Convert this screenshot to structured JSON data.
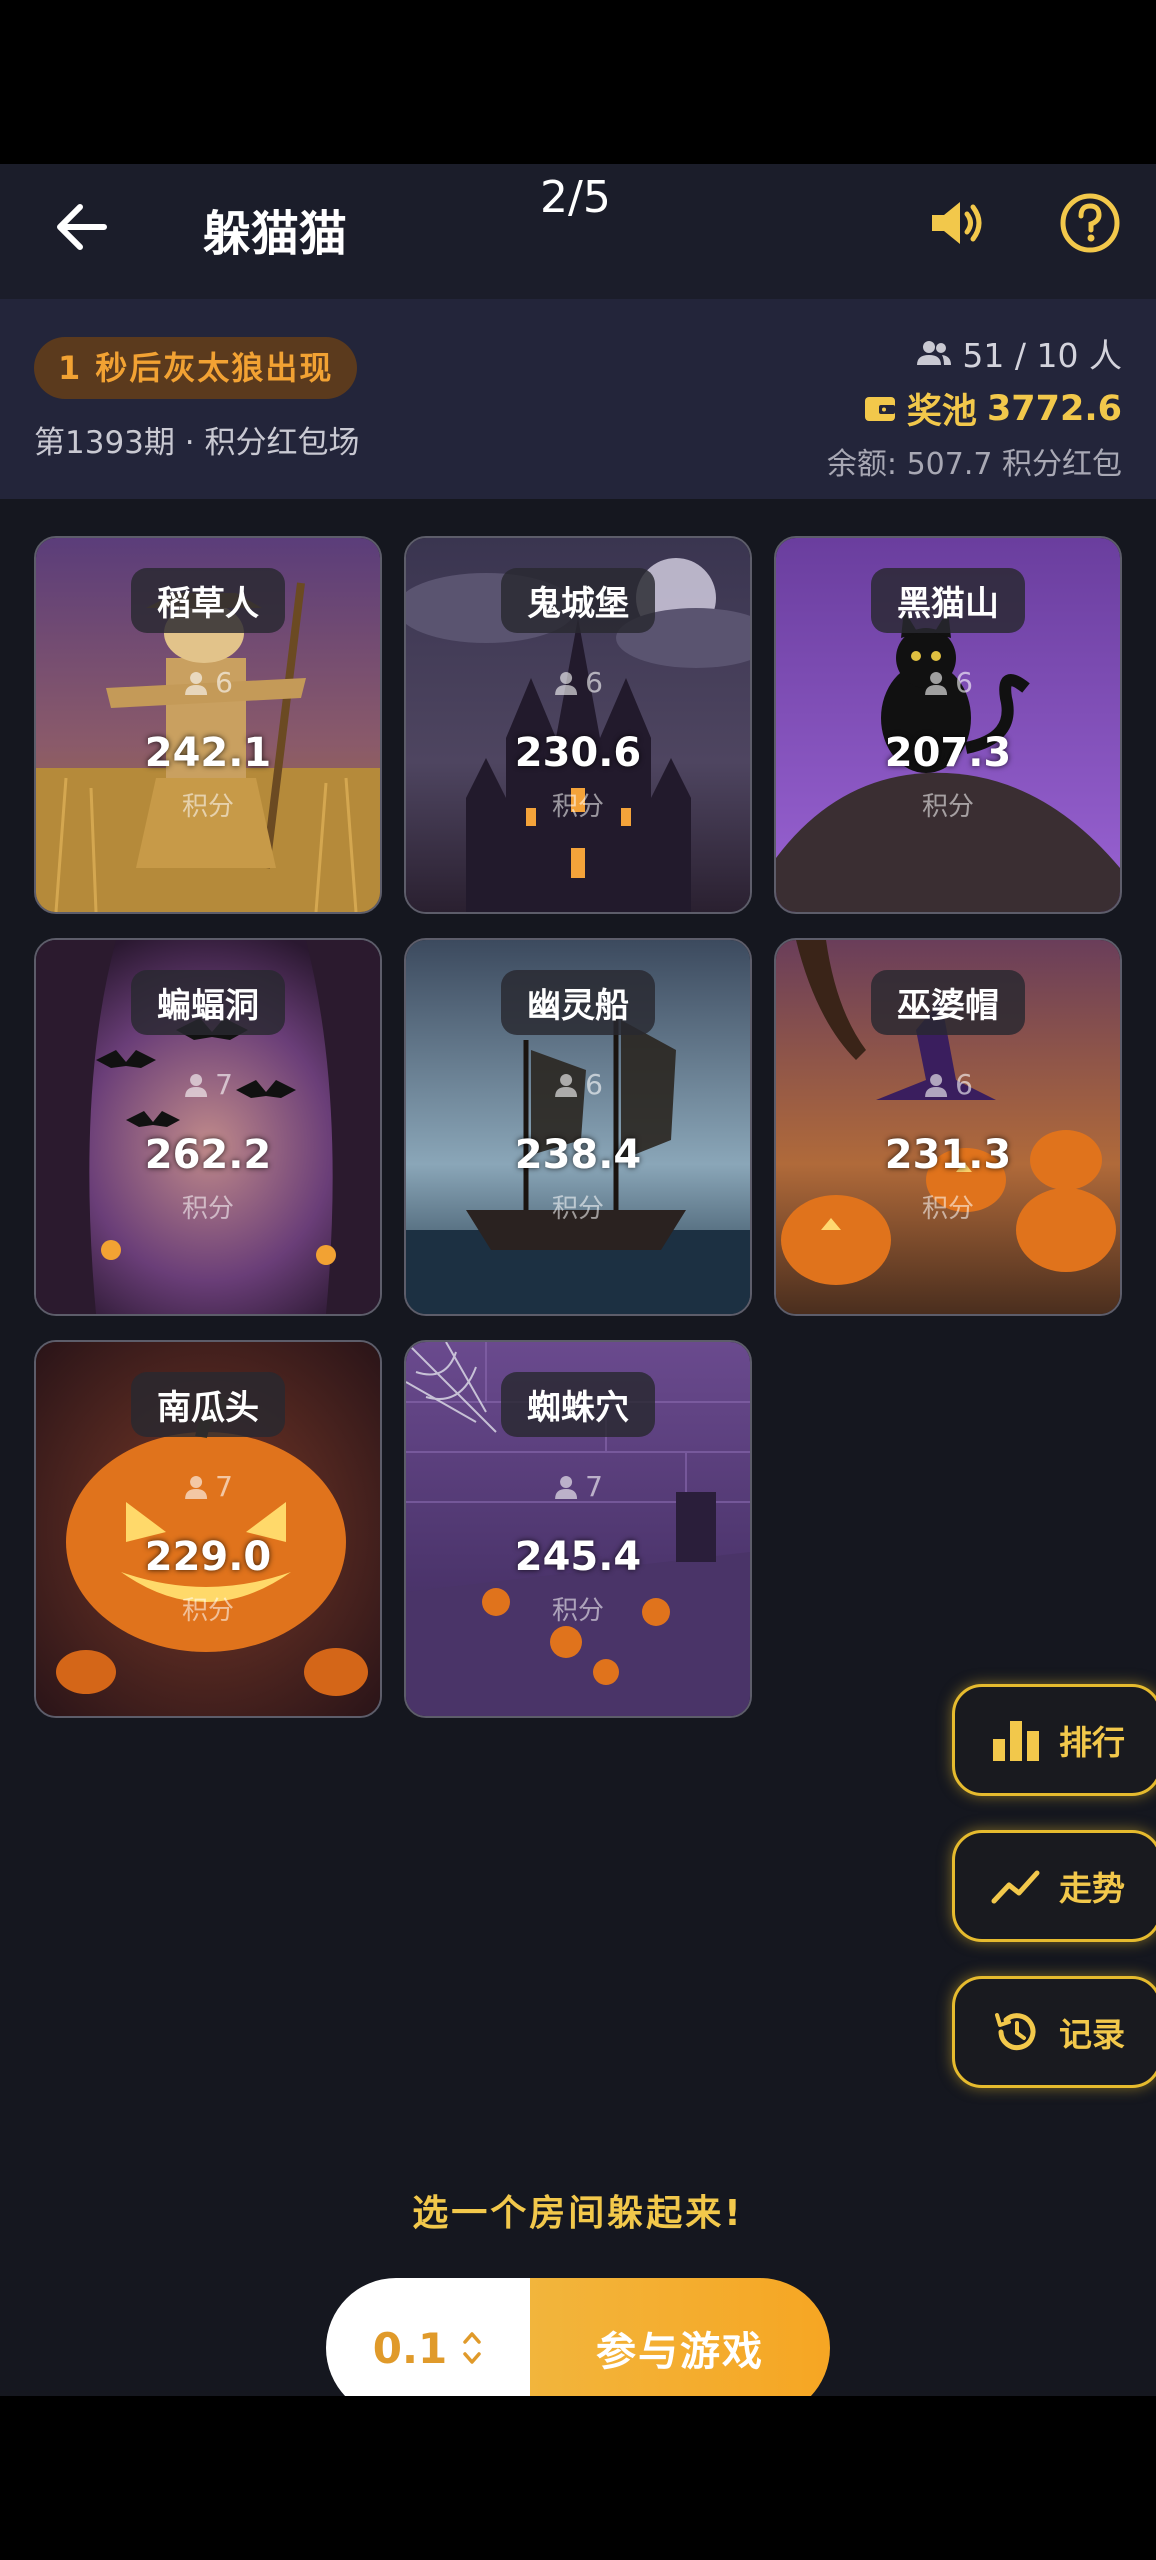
{
  "header": {
    "title": "躲猫猫",
    "page_indicator": "2/5"
  },
  "info": {
    "countdown": "1 秒后灰太狼出现",
    "period": "第1393期 · 积分红包场",
    "players": "51 / 10 人",
    "pool_label": "奖池",
    "pool_value": "3772.6",
    "balance": "余额: 507.7 积分红包"
  },
  "rooms": [
    {
      "name": "稻草人",
      "count": "6",
      "value": "242.1",
      "unit": "积分"
    },
    {
      "name": "鬼城堡",
      "count": "6",
      "value": "230.6",
      "unit": "积分"
    },
    {
      "name": "黑猫山",
      "count": "6",
      "value": "207.3",
      "unit": "积分"
    },
    {
      "name": "蝙蝠洞",
      "count": "7",
      "value": "262.2",
      "unit": "积分"
    },
    {
      "name": "幽灵船",
      "count": "6",
      "value": "238.4",
      "unit": "积分"
    },
    {
      "name": "巫婆帽",
      "count": "6",
      "value": "231.3",
      "unit": "积分"
    },
    {
      "name": "南瓜头",
      "count": "7",
      "value": "229.0",
      "unit": "积分"
    },
    {
      "name": "蜘蛛穴",
      "count": "7",
      "value": "245.4",
      "unit": "积分"
    }
  ],
  "side": {
    "rank": "排行",
    "trend": "走势",
    "record": "记录"
  },
  "footer": {
    "hint": "选一个房间躲起来!",
    "amount": "0.1",
    "join": "参与游戏"
  },
  "colors": {
    "accent": "#f2c84b",
    "background": "#15171f"
  }
}
